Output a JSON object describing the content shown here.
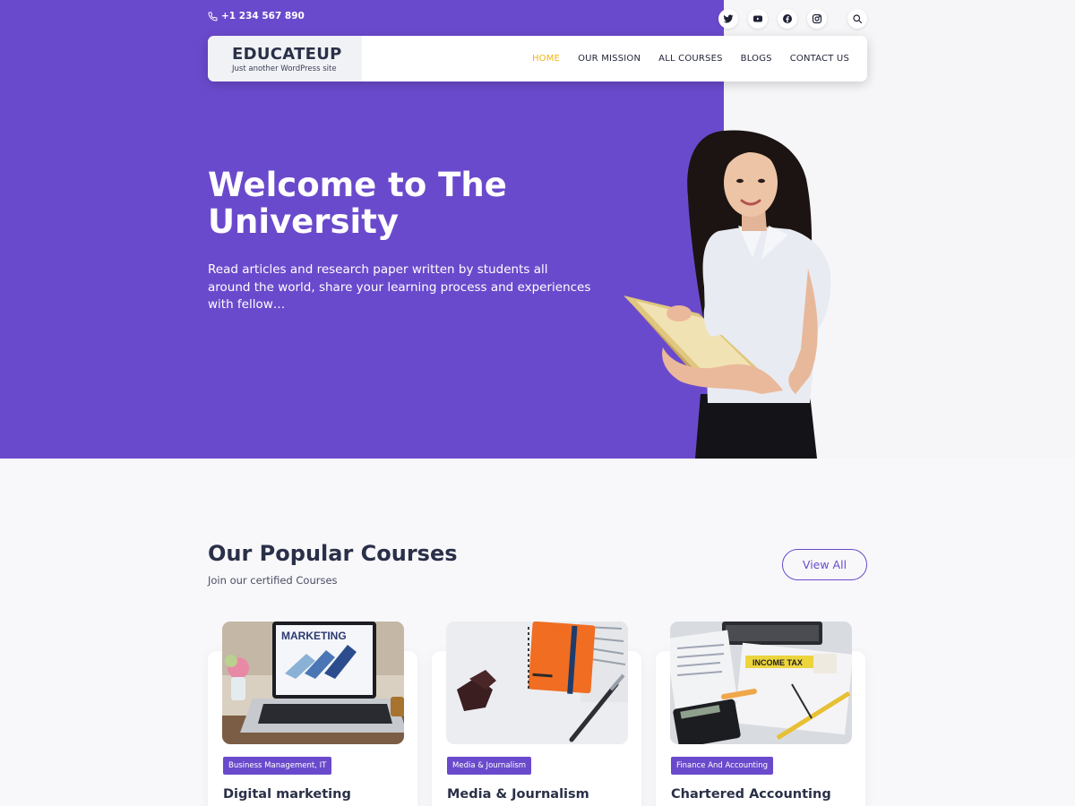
{
  "topbar": {
    "phone": "+1 234 567 890",
    "socials": [
      "twitter-icon",
      "youtube-icon",
      "facebook-icon",
      "instagram-icon"
    ],
    "search_icon": "search-icon"
  },
  "brand": {
    "title": "EDUCATEUP",
    "tagline": "Just another WordPress site"
  },
  "nav": {
    "items": [
      {
        "label": "HOME",
        "active": true
      },
      {
        "label": "OUR MISSION",
        "active": false
      },
      {
        "label": "ALL COURSES",
        "active": false
      },
      {
        "label": "BLOGS",
        "active": false
      },
      {
        "label": "CONTACT US",
        "active": false
      }
    ]
  },
  "hero": {
    "title": "Welcome to The University",
    "text": "Read articles and research paper written by students all around the world, share your learning process and experiences with fellow…"
  },
  "courses": {
    "title": "Our Popular Courses",
    "subtitle": "Join our certified Courses",
    "view_all": "View All",
    "items": [
      {
        "category": "Business Management, IT",
        "title": "Digital marketing",
        "image_text": "MARKETING"
      },
      {
        "category": "Media & Journalism",
        "title": "Media & Journalism"
      },
      {
        "category": "Finance And Accounting",
        "title": "Chartered Accounting",
        "image_text": "INCOME TAX"
      }
    ]
  },
  "colors": {
    "primary": "#6a4acc",
    "accent": "#f2b414",
    "heading": "#2a3048",
    "background": "#f8f8fb"
  }
}
